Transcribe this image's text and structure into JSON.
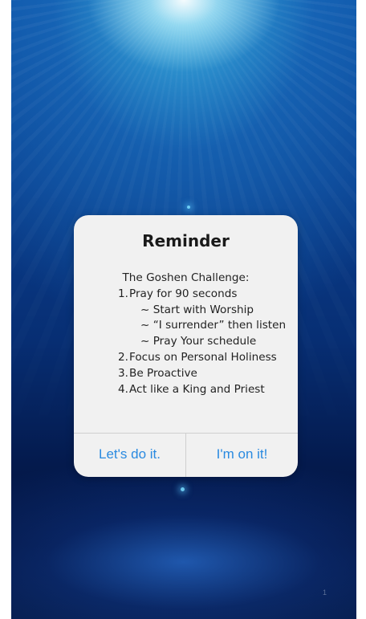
{
  "dialog": {
    "title": "Reminder",
    "intro": "The Goshen Challenge:",
    "steps": [
      {
        "number": "1.",
        "text": "Pray for 90 seconds",
        "subitems": [
          "~ Start with Worship",
          "~ “I surrender” then listen",
          "~ Pray Your schedule"
        ]
      },
      {
        "number": "2.",
        "text": "Focus on Personal Holiness"
      },
      {
        "number": "3.",
        "text": "Be Proactive"
      },
      {
        "number": "4.",
        "text": "Act like a King and Priest"
      }
    ],
    "buttons": {
      "left_label": "Let's do it.",
      "right_label": "I'm on it!"
    }
  },
  "page_number": "1",
  "colors": {
    "button_text": "#2a8ae0",
    "dialog_background": "#f1f1f1",
    "background_deep_blue": "#03123a",
    "background_light_blue": "#46c8f0"
  }
}
